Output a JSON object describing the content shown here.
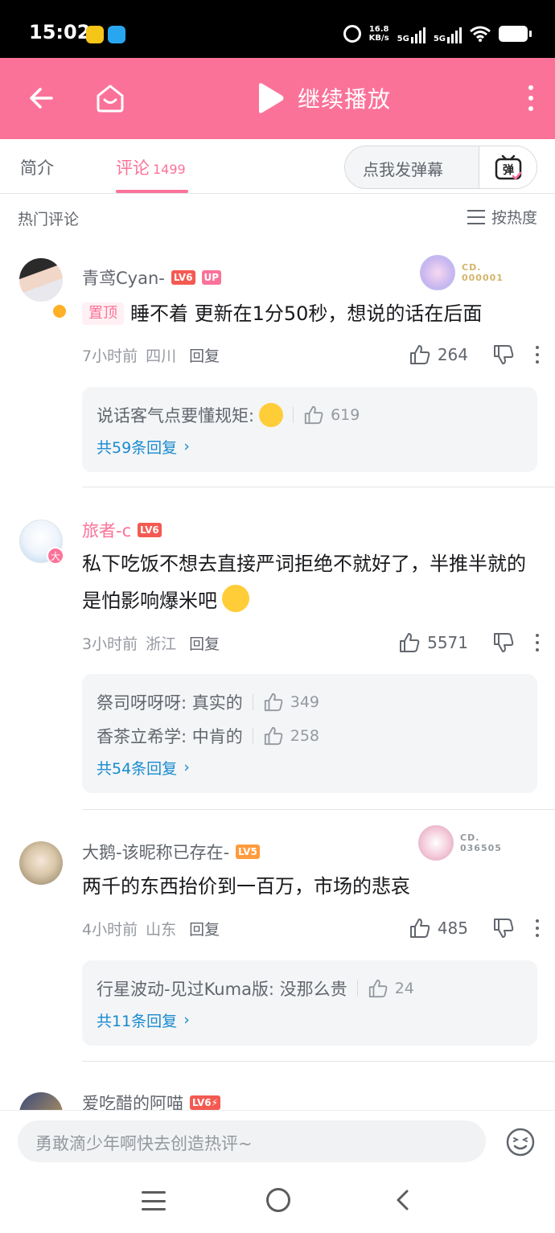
{
  "status_bar": {
    "time": "15:02",
    "net_speed_value": "16.8",
    "net_speed_unit": "KB/s",
    "sig1": "5G",
    "sig2": "5G"
  },
  "header": {
    "continue_label": "继续播放"
  },
  "tabs": {
    "intro": "简介",
    "comments": "评论",
    "comments_count": "1499",
    "danmaku_placeholder": "点我发弹幕",
    "danmaku_btn": "弹"
  },
  "sort_bar": {
    "title": "热门评论",
    "sort_label": "按热度"
  },
  "comments": [
    {
      "username": "青鸢Cyan-",
      "level": "LV6",
      "up_badge": "UP",
      "fan_badge_label": "CD.",
      "fan_badge_no": "000001",
      "pin_tag": "置顶",
      "text": "睡不着 更新在1分50秒，想说的话在后面",
      "time": "7小时前",
      "location": "四川",
      "reply_label": "回复",
      "likes": "264",
      "replies": [
        {
          "text": "说话客气点要懂规矩:",
          "likes": "619"
        }
      ],
      "more_replies": "共59条回复"
    },
    {
      "username": "旅者-c",
      "level": "LV6",
      "avatar_badge": "大",
      "text": "私下吃饭不想去直接严词拒绝不就好了，半推半就的是怕影响爆米吧",
      "time": "3小时前",
      "location": "浙江",
      "reply_label": "回复",
      "likes": "5571",
      "replies": [
        {
          "text": "祭司呀呀呀: 真实的",
          "likes": "349"
        },
        {
          "text": "香茶立希学: 中肯的",
          "likes": "258"
        }
      ],
      "more_replies": "共54条回复"
    },
    {
      "username": "大鹅-该昵称已存在-",
      "level": "LV5",
      "fan_badge_label": "CD.",
      "fan_badge_no": "036505",
      "text": "两千的东西抬价到一百万，市场的悲哀",
      "time": "4小时前",
      "location": "山东",
      "reply_label": "回复",
      "likes": "485",
      "replies": [
        {
          "text": "行星波动-见过Kuma版: 没那么贵",
          "likes": "24"
        }
      ],
      "more_replies": "共11条回复"
    },
    {
      "username": "爱吃醋的阿喵",
      "level": "LV6⚡"
    }
  ],
  "bottom_bar": {
    "reply_placeholder": "勇敢滴少年啊快去创造热评~"
  },
  "colors": {
    "brand_pink": "#fb7299",
    "link_blue": "#178bcf",
    "level_red": "#f45a52",
    "level_orange": "#ff9b3d"
  }
}
